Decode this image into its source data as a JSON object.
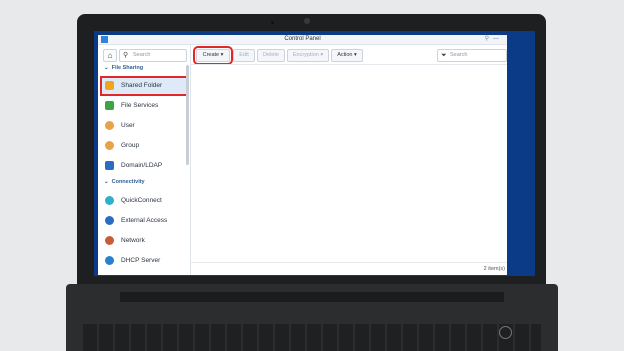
{
  "window": {
    "title": "Control Panel"
  },
  "sidebar": {
    "search_placeholder": "Search",
    "sections": [
      {
        "label": "File Sharing"
      },
      {
        "label": "Connectivity"
      }
    ],
    "items": [
      {
        "label": "Shared Folder",
        "color": "#f1a51f"
      },
      {
        "label": "File Services",
        "color": "#3aa545"
      },
      {
        "label": "User",
        "color": "#e8a24a"
      },
      {
        "label": "Group",
        "color": "#e8a24a"
      },
      {
        "label": "Domain/LDAP",
        "color": "#2a6cc3"
      },
      {
        "label": "QuickConnect",
        "color": "#2db0c9"
      },
      {
        "label": "External Access",
        "color": "#2a6cc3"
      },
      {
        "label": "Network",
        "color": "#c95a3a"
      },
      {
        "label": "DHCP Server",
        "color": "#2a7fd0"
      }
    ]
  },
  "toolbar": {
    "create": "Create ▾",
    "edit": "Edit",
    "delete": "Delete",
    "encryption": "Encryption ▾",
    "action": "Action ▾",
    "search_placeholder": "Search"
  },
  "footer": {
    "count": "2 item(s)"
  },
  "colors": {
    "accent": "#2f86d6",
    "highlight": "#e02828",
    "desktop": "#0b3a87"
  }
}
